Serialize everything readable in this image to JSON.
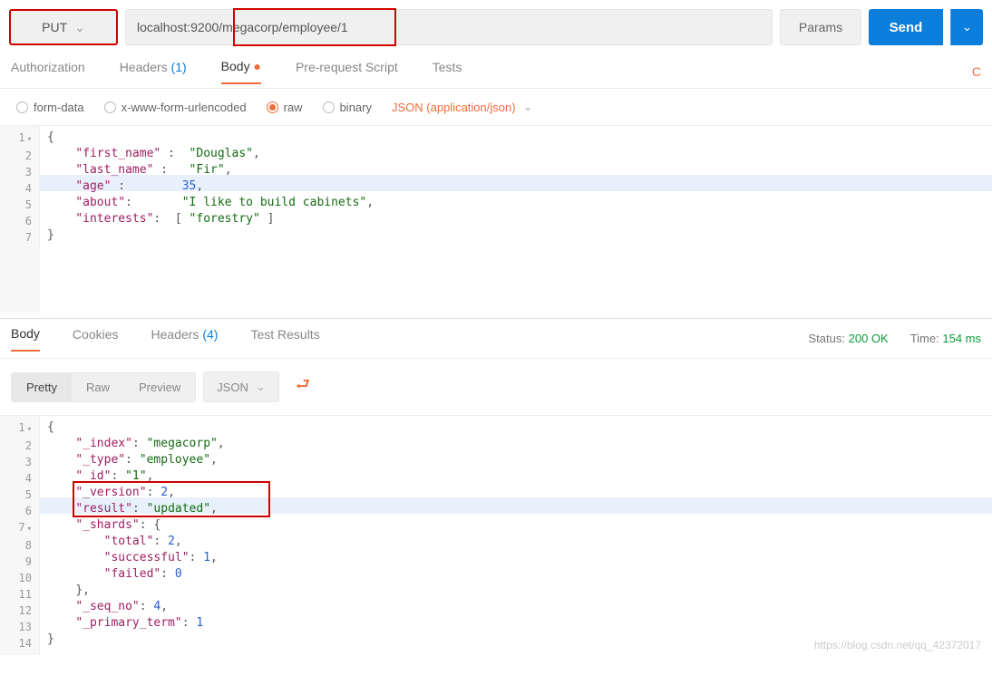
{
  "request": {
    "method": "PUT",
    "url": "localhost:9200/megacorp/employee/1",
    "params_label": "Params",
    "send_label": "Send"
  },
  "tabs": {
    "authorization": "Authorization",
    "headers": "Headers",
    "headers_count": "(1)",
    "body": "Body",
    "pre_request": "Pre-request Script",
    "tests": "Tests",
    "code_link": "C"
  },
  "body_opts": {
    "form_data": "form-data",
    "urlencoded": "x-www-form-urlencoded",
    "raw": "raw",
    "binary": "binary",
    "format": "JSON (application/json)"
  },
  "request_body": {
    "l1": "{",
    "l2": "    \"first_name\" :  \"Douglas\",",
    "l3": "    \"last_name\" :   \"Fir\",",
    "l4": "    \"age\" :        35,",
    "l5": "    \"about\":       \"I like to build cabinets\",",
    "l6": "    \"interests\":  [ \"forestry\" ]",
    "l7": "}"
  },
  "resp_tabs": {
    "body": "Body",
    "cookies": "Cookies",
    "headers": "Headers",
    "headers_count": "(4)",
    "test_results": "Test Results"
  },
  "resp_status": {
    "status_label": "Status:",
    "status_value": "200 OK",
    "time_label": "Time:",
    "time_value": "154 ms"
  },
  "resp_view": {
    "pretty": "Pretty",
    "raw": "Raw",
    "preview": "Preview",
    "format": "JSON"
  },
  "response_body": {
    "l1": "{",
    "l2a": "\"_index\"",
    "l2b": "\"megacorp\"",
    "l3a": "\"_type\"",
    "l3b": "\"employee\"",
    "l4a": "\"_id\"",
    "l4b": "\"1\"",
    "l5a": "\"_version\"",
    "l5b": "2",
    "l6a": "\"result\"",
    "l6b": "\"updated\"",
    "l7a": "\"_shards\"",
    "l8a": "\"total\"",
    "l8b": "2",
    "l9a": "\"successful\"",
    "l9b": "1",
    "l10a": "\"failed\"",
    "l10b": "0",
    "l12a": "\"_seq_no\"",
    "l12b": "4",
    "l13a": "\"_primary_term\"",
    "l13b": "1"
  },
  "watermark": "https://blog.csdn.net/qq_42372017"
}
